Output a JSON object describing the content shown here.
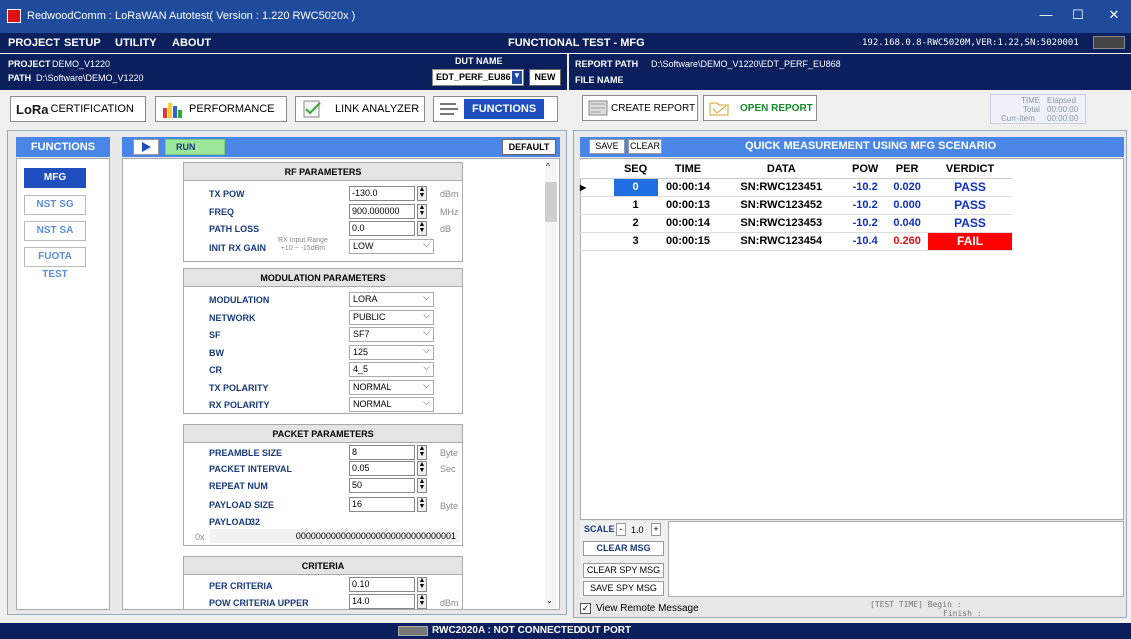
{
  "window": {
    "title": "RedwoodComm : LoRaWAN Autotest( Version : 1.220  RWC5020x )",
    "controls": {
      "minimize": "—",
      "maximize": "☐",
      "close": "✕"
    }
  },
  "menu": {
    "items": [
      "PROJECT",
      "SETUP",
      "UTILITY",
      "ABOUT"
    ],
    "center_title": "FUNCTIONAL TEST - MFG",
    "connection_info": "192.168.0.8-RWC5020M,VER:1.22,SN:5020001"
  },
  "project": {
    "project_label": "PROJECT",
    "project_value": "DEMO_V1220",
    "path_label": "PATH",
    "path_value": "D:\\Software\\DEMO_V1220",
    "dut_name_label": "DUT NAME",
    "dut_name_value": "EDT_PERF_EU86",
    "new_label": "NEW"
  },
  "report": {
    "report_path_label": "REPORT PATH",
    "report_path_value": "D:\\Software\\DEMO_V1220\\EDT_PERF_EU868",
    "file_name_label": "FILE NAME",
    "create_report_label": "CREATE REPORT",
    "open_report_label": "OPEN REPORT",
    "time_label": "TIME",
    "elapsed_label": "Elapsed",
    "total_label": "Total",
    "total_value": "00:00:00",
    "curr_item_label": "Curr-Item",
    "curr_item_value": "00:00:00"
  },
  "toolbar": {
    "lora_cert": "CERTIFICATION",
    "lora_word": "LoRa",
    "performance": "PERFORMANCE",
    "link_analyzer": "LINK ANALYZER",
    "functions": "FUNCTIONS"
  },
  "functions_panel": {
    "header": "FUNCTIONS",
    "run_label": "RUN",
    "default_label": "DEFAULT",
    "side_items": [
      "MFG",
      "NST SG",
      "NST SA",
      "FUOTA TEST"
    ],
    "active_item": "MFG"
  },
  "rf": {
    "title": "RF PARAMETERS",
    "tx_pow_label": "TX POW",
    "tx_pow_value": "-130.0",
    "tx_pow_unit": "dBm",
    "freq_label": "FREQ",
    "freq_value": "900.000000",
    "freq_unit": "MHz",
    "path_loss_label": "PATH LOSS",
    "path_loss_value": "0.0",
    "path_loss_unit": "dB",
    "init_rx_gain_label": "INIT RX GAIN",
    "rx_range_label": "RX Input Range",
    "rx_range_value": "+10 ~ -15dBm",
    "init_rx_gain_value": "LOW"
  },
  "modulation": {
    "title": "MODULATION PARAMETERS",
    "rows": [
      {
        "label": "MODULATION",
        "value": "LORA"
      },
      {
        "label": "NETWORK",
        "value": "PUBLIC"
      },
      {
        "label": "SF",
        "value": "SF7"
      },
      {
        "label": "BW",
        "value": "125"
      },
      {
        "label": "CR",
        "value": "4_5"
      },
      {
        "label": "TX POLARITY",
        "value": "NORMAL"
      },
      {
        "label": "RX POLARITY",
        "value": "NORMAL"
      }
    ]
  },
  "packet": {
    "title": "PACKET PARAMETERS",
    "preamble_label": "PREAMBLE SIZE",
    "preamble_value": "8",
    "preamble_unit": "Byte",
    "interval_label": "PACKET INTERVAL",
    "interval_value": "0.05",
    "interval_unit": "Sec",
    "repeat_label": "REPEAT NUM",
    "repeat_value": "50",
    "payload_size_label": "PAYLOAD SIZE",
    "payload_size_value": "16",
    "payload_size_unit": "Byte",
    "payload_label": "PAYLOAD",
    "payload_len": "32",
    "payload_prefix": "0x",
    "payload_value": "00000000000000000000000000000001"
  },
  "criteria": {
    "title": "CRITERIA",
    "per_label": "PER CRITERIA",
    "per_value": "0.10",
    "pow_upper_label": "POW CRITERIA UPPER",
    "pow_upper_value": "14.0",
    "pow_upper_unit": "dBm"
  },
  "measurement": {
    "save_label": "SAVE",
    "clear_label": "CLEAR",
    "title": "QUICK MEASUREMENT USING MFG SCENARIO",
    "columns": [
      "SEQ",
      "TIME",
      "DATA",
      "POW",
      "PER",
      "VERDICT"
    ],
    "rows": [
      {
        "seq": "0",
        "time": "00:00:14",
        "data": "SN:RWC123451",
        "pow": "-10.2",
        "per": "0.020",
        "verdict": "PASS"
      },
      {
        "seq": "1",
        "time": "00:00:13",
        "data": "SN:RWC123452",
        "pow": "-10.2",
        "per": "0.000",
        "verdict": "PASS"
      },
      {
        "seq": "2",
        "time": "00:00:14",
        "data": "SN:RWC123453",
        "pow": "-10.2",
        "per": "0.040",
        "verdict": "PASS"
      },
      {
        "seq": "3",
        "time": "00:00:15",
        "data": "SN:RWC123454",
        "pow": "-10.4",
        "per": "0.260",
        "verdict": "FAIL"
      }
    ]
  },
  "log": {
    "scale_label": "SCALE",
    "scale_minus": "-",
    "scale_value": "1.0",
    "scale_plus": "+",
    "clear_msg": "CLEAR MSG",
    "clear_spy_msg": "CLEAR SPY MSG",
    "save_spy_msg": "SAVE SPY MSG",
    "view_remote_label": "View Remote Message",
    "test_time_label": "[TEST TIME] Begin  :",
    "finish_label": "Finish :"
  },
  "status": {
    "device": "RWC2020A : NOT CONNECTED",
    "dut_port": "DUT PORT"
  },
  "colors": {
    "accent": "#4a86e8",
    "dark_navy": "#0a1f5c",
    "pass": "#1030c0",
    "fail_bg": "#ff0000"
  }
}
